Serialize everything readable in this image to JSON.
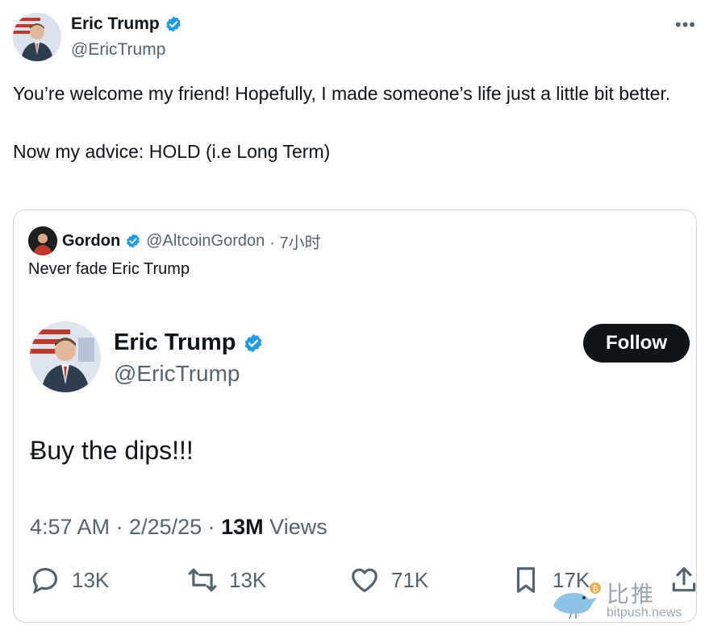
{
  "tweet": {
    "author_name": "Eric Trump",
    "author_handle": "@EricTrump",
    "more_icon": "more-horizontal-icon",
    "text_line1": "You’re welcome my friend! Hopefully, I made someone’s life just a little bit better.",
    "text_line2": "Now my advice: HOLD (i.e Long Term)"
  },
  "quote": {
    "author_name": "Gordon",
    "author_handle": "@AltcoinGordon",
    "time": "· 7小时",
    "text": "Never fade Eric Trump",
    "embedded": {
      "author_name": "Eric Trump",
      "author_handle": "@EricTrump",
      "follow_label": "Follow",
      "text": "Ƀuy the dips!!!",
      "time": "4:57 AM · 2/25/25 · ",
      "views_count": "13M",
      "views_label": " Views",
      "actions": {
        "reply_count": "13K",
        "retweet_count": "13K",
        "like_count": "71K",
        "bookmark_count": "17K"
      }
    }
  },
  "watermark": {
    "cn": "比推",
    "en": "bitpush.news"
  },
  "colors": {
    "verified": "#1d9bf0",
    "text": "#0f1419",
    "secondary": "#536471",
    "border": "#cfd9de"
  }
}
